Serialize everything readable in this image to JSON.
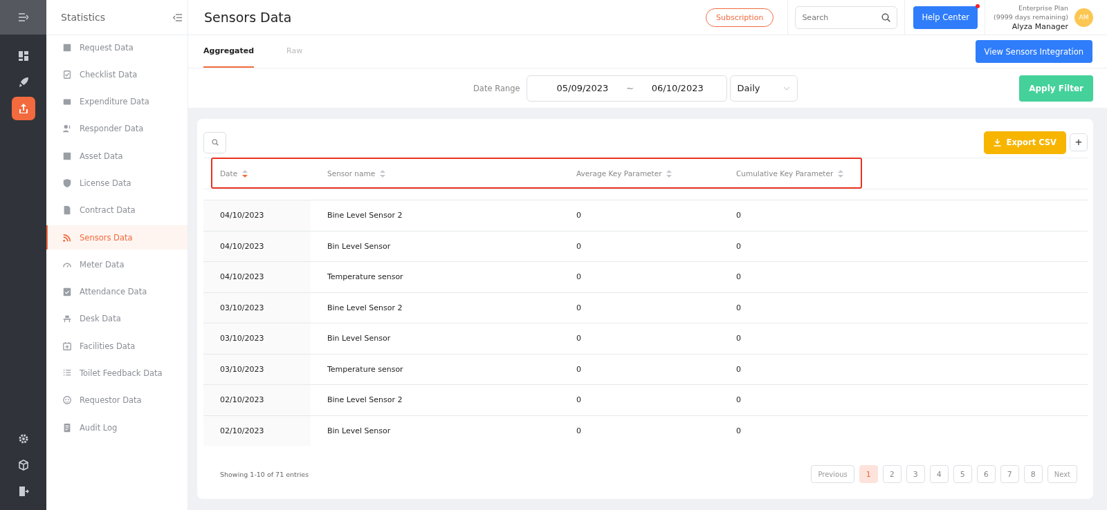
{
  "rail": {
    "items": [
      {
        "kind": "dashboard",
        "selected": false
      },
      {
        "kind": "rocket",
        "selected": false
      },
      {
        "kind": "chart",
        "selected": true
      }
    ],
    "bottom_items": [
      {
        "kind": "settings"
      },
      {
        "kind": "cube"
      },
      {
        "kind": "logout"
      }
    ]
  },
  "sidebar": {
    "title": "Statistics",
    "items": [
      {
        "label": "Request Data",
        "selected": false
      },
      {
        "label": "Checklist Data",
        "selected": false
      },
      {
        "label": "Expenditure Data",
        "selected": false
      },
      {
        "label": "Responder Data",
        "selected": false
      },
      {
        "label": "Asset Data",
        "selected": false
      },
      {
        "label": "License Data",
        "selected": false
      },
      {
        "label": "Contract Data",
        "selected": false
      },
      {
        "label": "Sensors Data",
        "selected": true
      },
      {
        "label": "Meter Data",
        "selected": false
      },
      {
        "label": "Attendance Data",
        "selected": false
      },
      {
        "label": "Desk Data",
        "selected": false
      },
      {
        "label": "Facilities Data",
        "selected": false
      },
      {
        "label": "Toilet Feedback Data",
        "selected": false
      },
      {
        "label": "Requestor Data",
        "selected": false
      },
      {
        "label": "Audit Log",
        "selected": false
      }
    ]
  },
  "header": {
    "title": "Sensors Data",
    "subscription": "Subscription",
    "search": {
      "placeholder": "Search"
    },
    "help": "Help Center",
    "help_notification": true,
    "plan": "Enterprise Plan",
    "plan_remaining": "(9999 days remaining)",
    "user": "Alyza Manager",
    "avatar": "AM"
  },
  "tabs": [
    {
      "label": "Aggregated",
      "selected": true
    },
    {
      "label": "Raw",
      "selected": false
    }
  ],
  "integration_button": "View Sensors Integration",
  "filter": {
    "label": "Date Range",
    "start": "05/09/2023",
    "separator": "~",
    "end": "06/10/2023",
    "period": "Daily",
    "apply": "Apply Filter"
  },
  "table": {
    "export": "Export CSV",
    "add": "+",
    "columns": [
      {
        "label": "Date",
        "sorted": true
      },
      {
        "label": "Sensor name",
        "sorted": false
      },
      {
        "label": "Average Key Parameter",
        "sorted": false
      },
      {
        "label": "Cumulative Key Parameter",
        "sorted": false
      }
    ],
    "rows": [
      [
        "04/10/2023",
        "Bine Level Sensor 2",
        "0",
        "0"
      ],
      [
        "04/10/2023",
        "Bin Level Sensor",
        "0",
        "0"
      ],
      [
        "04/10/2023",
        "Temperature sensor",
        "0",
        "0"
      ],
      [
        "03/10/2023",
        "Bine Level Sensor 2",
        "0",
        "0"
      ],
      [
        "03/10/2023",
        "Bin Level Sensor",
        "0",
        "0"
      ],
      [
        "03/10/2023",
        "Temperature sensor",
        "0",
        "0"
      ],
      [
        "02/10/2023",
        "Bine Level Sensor 2",
        "0",
        "0"
      ],
      [
        "02/10/2023",
        "Bin Level Sensor",
        "0",
        "0"
      ]
    ],
    "summary": "Showing 1-10 of 71 entries",
    "pagination": {
      "previous": "Previous",
      "next": "Next",
      "pages": [
        {
          "label": "1",
          "selected": true
        },
        {
          "label": "2",
          "selected": false
        },
        {
          "label": "3",
          "selected": false
        },
        {
          "label": "4",
          "selected": false
        },
        {
          "label": "5",
          "selected": false
        },
        {
          "label": "6",
          "selected": false
        },
        {
          "label": "7",
          "selected": false
        },
        {
          "label": "8",
          "selected": false
        }
      ]
    }
  }
}
